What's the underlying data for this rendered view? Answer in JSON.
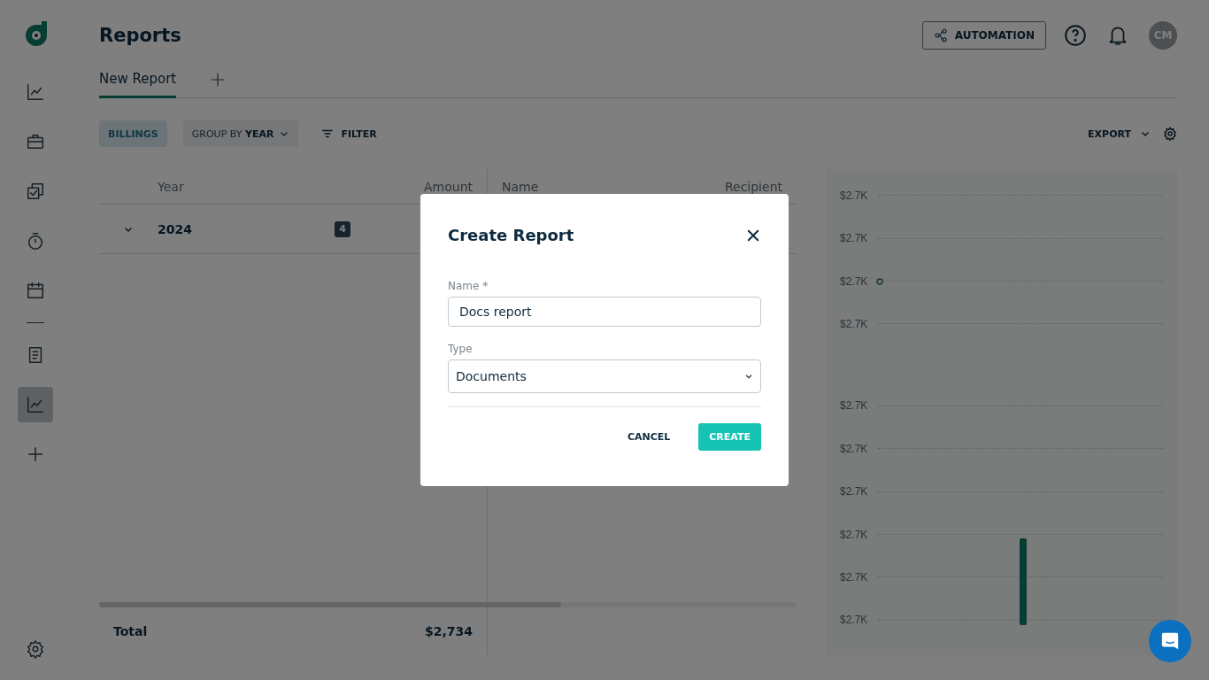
{
  "sidebar": {
    "items": [
      {
        "selected": false
      },
      {
        "selected": false
      },
      {
        "selected": false
      },
      {
        "selected": false
      },
      {
        "selected": false
      },
      {
        "selected": false
      },
      {
        "selected": true
      },
      {
        "selected": false
      }
    ]
  },
  "header": {
    "title": "Reports",
    "automation_button": "AUTOMATION",
    "avatar": "CM"
  },
  "tabs": [
    {
      "label": "New Report",
      "selected": true
    }
  ],
  "toolbar": {
    "billings": "BILLINGS",
    "group_by": {
      "label": "GROUP BY",
      "value": "YEAR"
    },
    "filter": "FILTER",
    "export": "EXPORT"
  },
  "table": {
    "columns": [
      "Year",
      "Amount",
      "Name",
      "Recipient"
    ],
    "rows": [
      {
        "year": "2024",
        "count": "4",
        "expanded": true
      }
    ],
    "total": {
      "label": "Total",
      "amount": "$2,734"
    }
  },
  "chart": {
    "axis_labels": [
      "$2.7K",
      "$2.7K",
      "$2.7K",
      "$2.7K",
      "$2.7K",
      "$2.7K",
      "$2.7K",
      "$2.7K",
      "$2.7K",
      "$2.7K"
    ]
  },
  "dialog": {
    "title": "Create Report",
    "fields": [
      {
        "kind": "text",
        "label": "Name *",
        "value": "Docs report"
      },
      {
        "kind": "select",
        "label": "Type",
        "value": "Documents"
      }
    ],
    "buttons": [
      {
        "kind": "secondary",
        "label": "CANCEL"
      },
      {
        "kind": "primary",
        "label": "CREATE"
      }
    ]
  }
}
